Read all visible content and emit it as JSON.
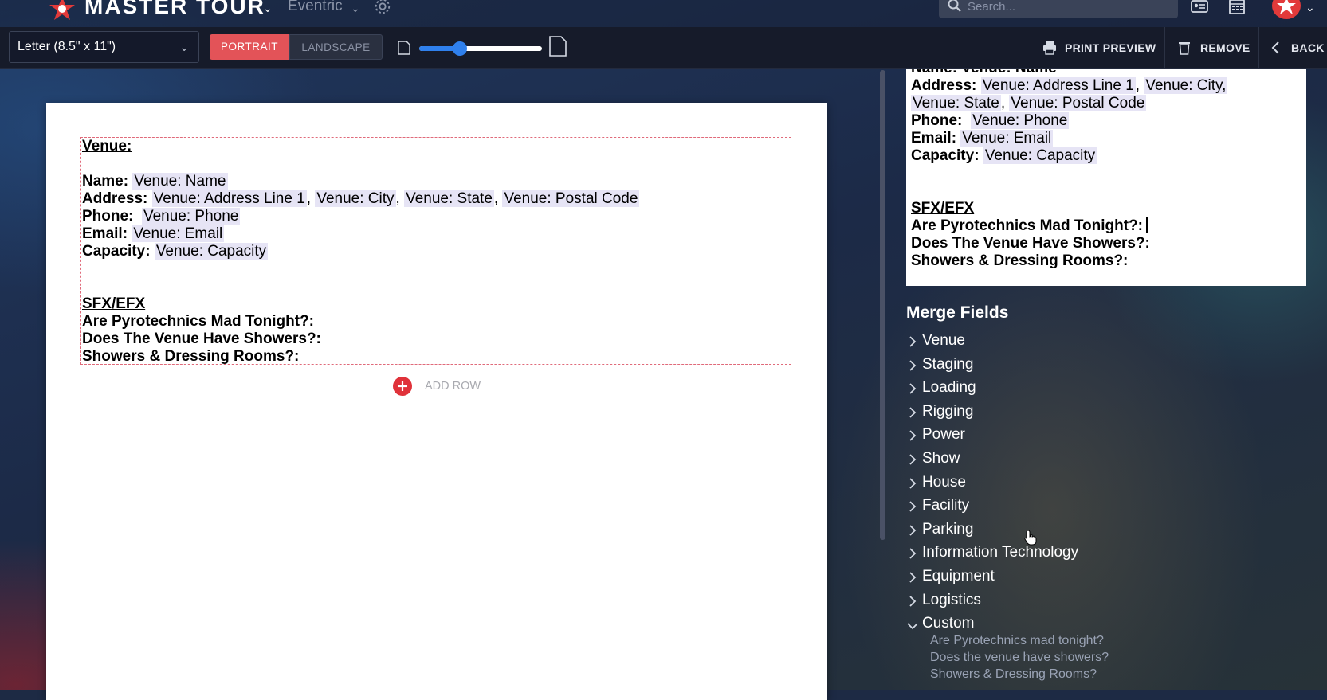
{
  "header": {
    "brand": "MASTER TOUR",
    "org": "Eventric",
    "search_placeholder": "Search...",
    "icons": [
      "logo-icon",
      "chevron-down-icon",
      "gear-icon",
      "search-icon",
      "ticket-icon",
      "calendar-icon",
      "avatar",
      "chevron-down-icon"
    ],
    "accent_color": "#e35358"
  },
  "toolbar": {
    "paper_size": "Letter (8.5\" x 11\")",
    "portrait_label": "PORTRAIT",
    "landscape_label": "LANDSCAPE",
    "orientation_selected": "portrait",
    "zoom_fraction": 0.33,
    "print_preview_label": "PRINT PREVIEW",
    "remove_label": "REMOVE",
    "back_label": "BACK"
  },
  "document": {
    "venue_heading": "Venue:",
    "name_label": "Name:",
    "name_value": "Venue: Name",
    "address_label": "Address:",
    "address_line1": "Venue: Address Line 1",
    "address_city": "Venue: City",
    "address_state": "Venue: State",
    "address_postal": "Venue: Postal Code",
    "phone_label": "Phone:",
    "phone_value": "Venue: Phone",
    "email_label": "Email:",
    "email_value": "Venue: Email",
    "capacity_label": "Capacity:",
    "capacity_value": "Venue: Capacity",
    "sfx_heading": "SFX/EFX",
    "q1": "Are Pyrotechnics Mad Tonight?:",
    "q2": "Does The Venue Have Showers?:",
    "q3": "Showers & Dressing Rooms?:",
    "add_row_label": "ADD ROW"
  },
  "preview": {
    "cut_line": "Name: Venue: Name",
    "address_label": "Address:",
    "address_line1": "Venue: Address Line 1",
    "address_city": "Venue: City,",
    "address_state": "Venue: State",
    "address_postal": "Venue: Postal Code",
    "phone_label": "Phone:",
    "phone_value": "Venue: Phone",
    "email_label": "Email:",
    "email_value": "Venue: Email",
    "capacity_label": "Capacity:",
    "capacity_value": "Venue: Capacity",
    "sfx_heading": "SFX/EFX",
    "q1": "Are Pyrotechnics Mad Tonight?:",
    "q2": "Does The Venue Have Showers?:",
    "q3": "Showers & Dressing Rooms?:"
  },
  "merge_fields": {
    "title": "Merge Fields",
    "items": [
      {
        "label": "Venue",
        "expanded": false
      },
      {
        "label": "Staging",
        "expanded": false
      },
      {
        "label": "Loading",
        "expanded": false
      },
      {
        "label": "Rigging",
        "expanded": false
      },
      {
        "label": "Power",
        "expanded": false
      },
      {
        "label": "Show",
        "expanded": false
      },
      {
        "label": "House",
        "expanded": false
      },
      {
        "label": "Facility",
        "expanded": false
      },
      {
        "label": "Parking",
        "expanded": false
      },
      {
        "label": "Information Technology",
        "expanded": false
      },
      {
        "label": "Equipment",
        "expanded": false
      },
      {
        "label": "Logistics",
        "expanded": false
      },
      {
        "label": "Custom",
        "expanded": true
      }
    ],
    "custom_children": [
      "Are Pyrotechnics mad tonight?",
      "Does the venue have showers?",
      "Showers & Dressing Rooms?"
    ]
  }
}
